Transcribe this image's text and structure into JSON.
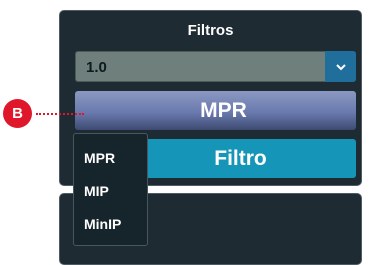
{
  "filters_panel": {
    "title": "Filtros",
    "select": {
      "value": "1.0",
      "arrow_icon": "chevron-down-icon"
    },
    "mpr_button_label": "MPR",
    "filtro_button_label": "Filtro"
  },
  "dropdown_menu": {
    "items": [
      "MPR",
      "MIP",
      "MinIP"
    ]
  },
  "callout": {
    "label": "B"
  },
  "colors": {
    "panel_bg": "#1e2b33",
    "select_bg": "#6f7f7b",
    "arrow_bg": "#1f6e9c",
    "mpr_button": "#6a7aae",
    "filtro_button": "#1596b8",
    "callout": "#e0172a"
  }
}
